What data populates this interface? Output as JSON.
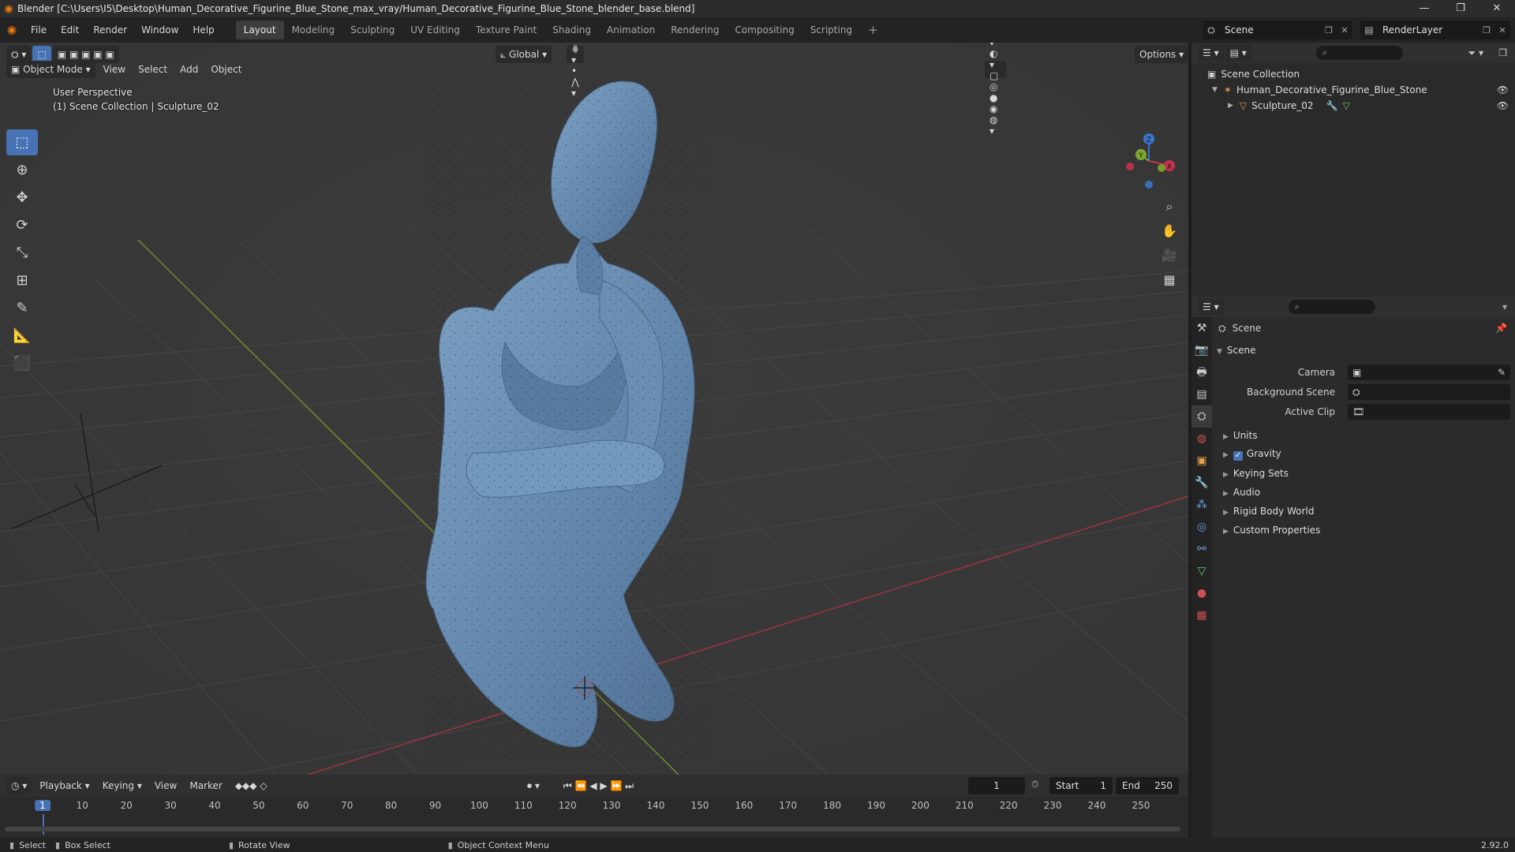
{
  "window": {
    "title": "Blender [C:\\Users\\I5\\Desktop\\Human_Decorative_Figurine_Blue_Stone_max_vray/Human_Decorative_Figurine_Blue_Stone_blender_base.blend]",
    "minimize": "—",
    "maximize": "❐",
    "close": "✕"
  },
  "menu": [
    "File",
    "Edit",
    "Render",
    "Window",
    "Help"
  ],
  "workspaces": [
    "Layout",
    "Modeling",
    "Sculpting",
    "UV Editing",
    "Texture Paint",
    "Shading",
    "Animation",
    "Rendering",
    "Compositing",
    "Scripting"
  ],
  "workspace_add": "+",
  "scene_selector": "Scene",
  "renderlayer_selector": "RenderLayer",
  "viewport": {
    "mode": "Object Mode",
    "menus": [
      "View",
      "Select",
      "Add",
      "Object"
    ],
    "transform_orientation": "Global",
    "options": "Options",
    "perspective": "User Perspective",
    "collection_info": "(1) Scene Collection | Sculpture_02",
    "gizmo_labels": {
      "x": "X",
      "y": "Y",
      "z": "Z"
    }
  },
  "outliner": {
    "root": "Scene Collection",
    "items": [
      {
        "name": "Human_Decorative_Figurine_Blue_Stone"
      },
      {
        "name": "Sculpture_02"
      }
    ]
  },
  "properties": {
    "context": "Scene",
    "panel": "Scene",
    "fields": [
      {
        "label": "Camera",
        "value": ""
      },
      {
        "label": "Background Scene",
        "value": ""
      },
      {
        "label": "Active Clip",
        "value": ""
      }
    ],
    "subpanels": [
      "Units",
      "Gravity",
      "Keying Sets",
      "Audio",
      "Rigid Body World",
      "Custom Properties"
    ]
  },
  "timeline": {
    "menus": [
      "Playback",
      "Keying",
      "View",
      "Marker"
    ],
    "current_frame": "1",
    "start_label": "Start",
    "start": "1",
    "end_label": "End",
    "end": "250",
    "ticks": [
      "1",
      "10",
      "20",
      "30",
      "40",
      "50",
      "60",
      "70",
      "80",
      "90",
      "100",
      "110",
      "120",
      "130",
      "140",
      "150",
      "160",
      "170",
      "180",
      "190",
      "200",
      "210",
      "220",
      "230",
      "240",
      "250"
    ]
  },
  "statusbar": {
    "select": "Select",
    "box_select": "Box Select",
    "rotate_view": "Rotate View",
    "context_menu": "Object Context Menu",
    "version": "2.92.0"
  },
  "colors": {
    "accent": "#4772b3",
    "blender_orange": "#e87d0d",
    "axis_x": "#c5324b",
    "axis_y": "#7ea82f",
    "axis_z": "#3a74c9",
    "figure": "#6a8fb3"
  }
}
